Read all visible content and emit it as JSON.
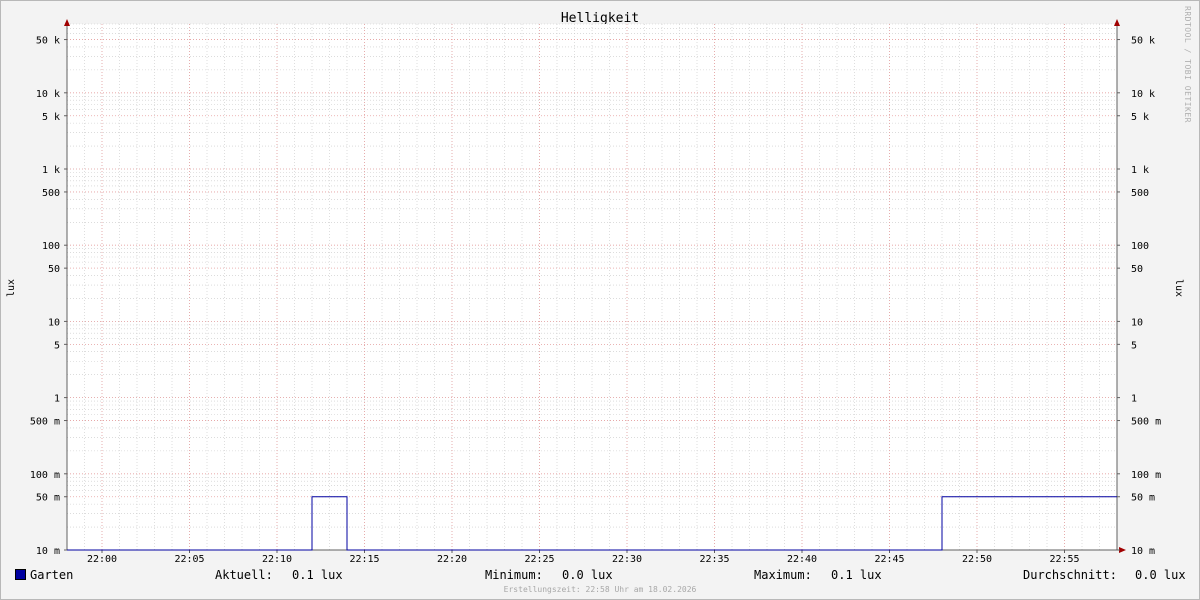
{
  "chart_data": {
    "type": "line",
    "title": "Helligkeit",
    "ylabel": "lux",
    "y_scale": "log",
    "ylim": [
      0.01,
      80000
    ],
    "y_ticks": [
      {
        "v": 50000,
        "label": "50 k"
      },
      {
        "v": 10000,
        "label": "10 k"
      },
      {
        "v": 5000,
        "label": "5 k"
      },
      {
        "v": 1000,
        "label": "1 k"
      },
      {
        "v": 500,
        "label": "500"
      },
      {
        "v": 100,
        "label": "100"
      },
      {
        "v": 50,
        "label": "50"
      },
      {
        "v": 10,
        "label": "10"
      },
      {
        "v": 5,
        "label": "5"
      },
      {
        "v": 1,
        "label": "1"
      },
      {
        "v": 0.5,
        "label": "500 m"
      },
      {
        "v": 0.1,
        "label": "100 m"
      },
      {
        "v": 0.05,
        "label": "50 m"
      },
      {
        "v": 0.01,
        "label": "10 m"
      }
    ],
    "x_ticks": [
      "22:00",
      "22:05",
      "22:10",
      "22:15",
      "22:20",
      "22:25",
      "22:30",
      "22:35",
      "22:40",
      "22:45",
      "22:50",
      "22:55"
    ],
    "xlim": [
      "21:58",
      "22:58"
    ],
    "grid": true,
    "series": [
      {
        "name": "Garten",
        "color": "#0000a0",
        "points": [
          [
            "21:58",
            0.01
          ],
          [
            "22:12",
            0.01
          ],
          [
            "22:12",
            0.05
          ],
          [
            "22:14",
            0.05
          ],
          [
            "22:14",
            0.01
          ],
          [
            "22:48",
            0.01
          ],
          [
            "22:48",
            0.05
          ],
          [
            "22:58",
            0.05
          ]
        ]
      }
    ]
  },
  "legend": {
    "series_name": "Garten",
    "aktuell_label": "Aktuell:",
    "aktuell_value": "0.1 lux",
    "minimum_label": "Minimum:",
    "minimum_value": "0.0 lux",
    "maximum_label": "Maximum:",
    "maximum_value": "0.1 lux",
    "durchschnitt_label": "Durchschnitt:",
    "durchschnitt_value": "0.0 lux"
  },
  "watermark": "RRDTOOL / TOBI OETIKER",
  "footer": "Erstellungszeit: 22:58 Uhr am 18.02.2026",
  "colors": {
    "major_grid": "#e8a0a0",
    "minor_grid": "#c8c8c8",
    "series": "#0000a0",
    "arrow": "#a00000"
  }
}
